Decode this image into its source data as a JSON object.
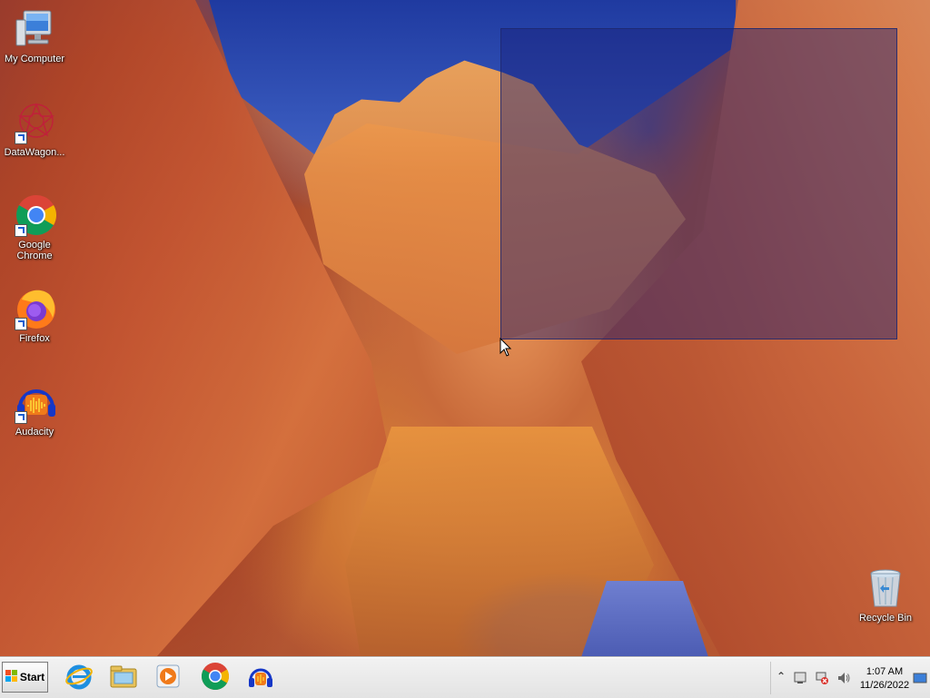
{
  "desktop": {
    "icons": [
      {
        "label": "My Computer",
        "icon": "computer-icon",
        "shortcut": false
      },
      {
        "label": "DataWagon...",
        "icon": "datawagon-icon",
        "shortcut": true
      },
      {
        "label": "Google Chrome",
        "icon": "chrome-icon",
        "shortcut": true
      },
      {
        "label": "Firefox",
        "icon": "firefox-icon",
        "shortcut": true
      },
      {
        "label": "Audacity",
        "icon": "audacity-icon",
        "shortcut": true
      }
    ],
    "recycle_bin": {
      "label": "Recycle Bin",
      "icon": "recycle-bin-icon"
    }
  },
  "taskbar": {
    "start_label": "Start",
    "pinned": [
      {
        "name": "Internet Explorer",
        "icon": "internet-explorer-icon"
      },
      {
        "name": "Windows Explorer",
        "icon": "file-explorer-icon"
      },
      {
        "name": "Media Player",
        "icon": "media-player-icon"
      },
      {
        "name": "Google Chrome",
        "icon": "chrome-icon"
      },
      {
        "name": "Audacity",
        "icon": "audacity-icon"
      }
    ],
    "tray": {
      "time": "1:07 AM",
      "date": "11/26/2022"
    }
  },
  "colors": {
    "selection_fill": "#182078",
    "taskbar_bg": "#ececec",
    "chrome_red": "#db4437",
    "chrome_yellow": "#f4b400",
    "chrome_green": "#0f9d58",
    "chrome_blue": "#4285f4"
  }
}
